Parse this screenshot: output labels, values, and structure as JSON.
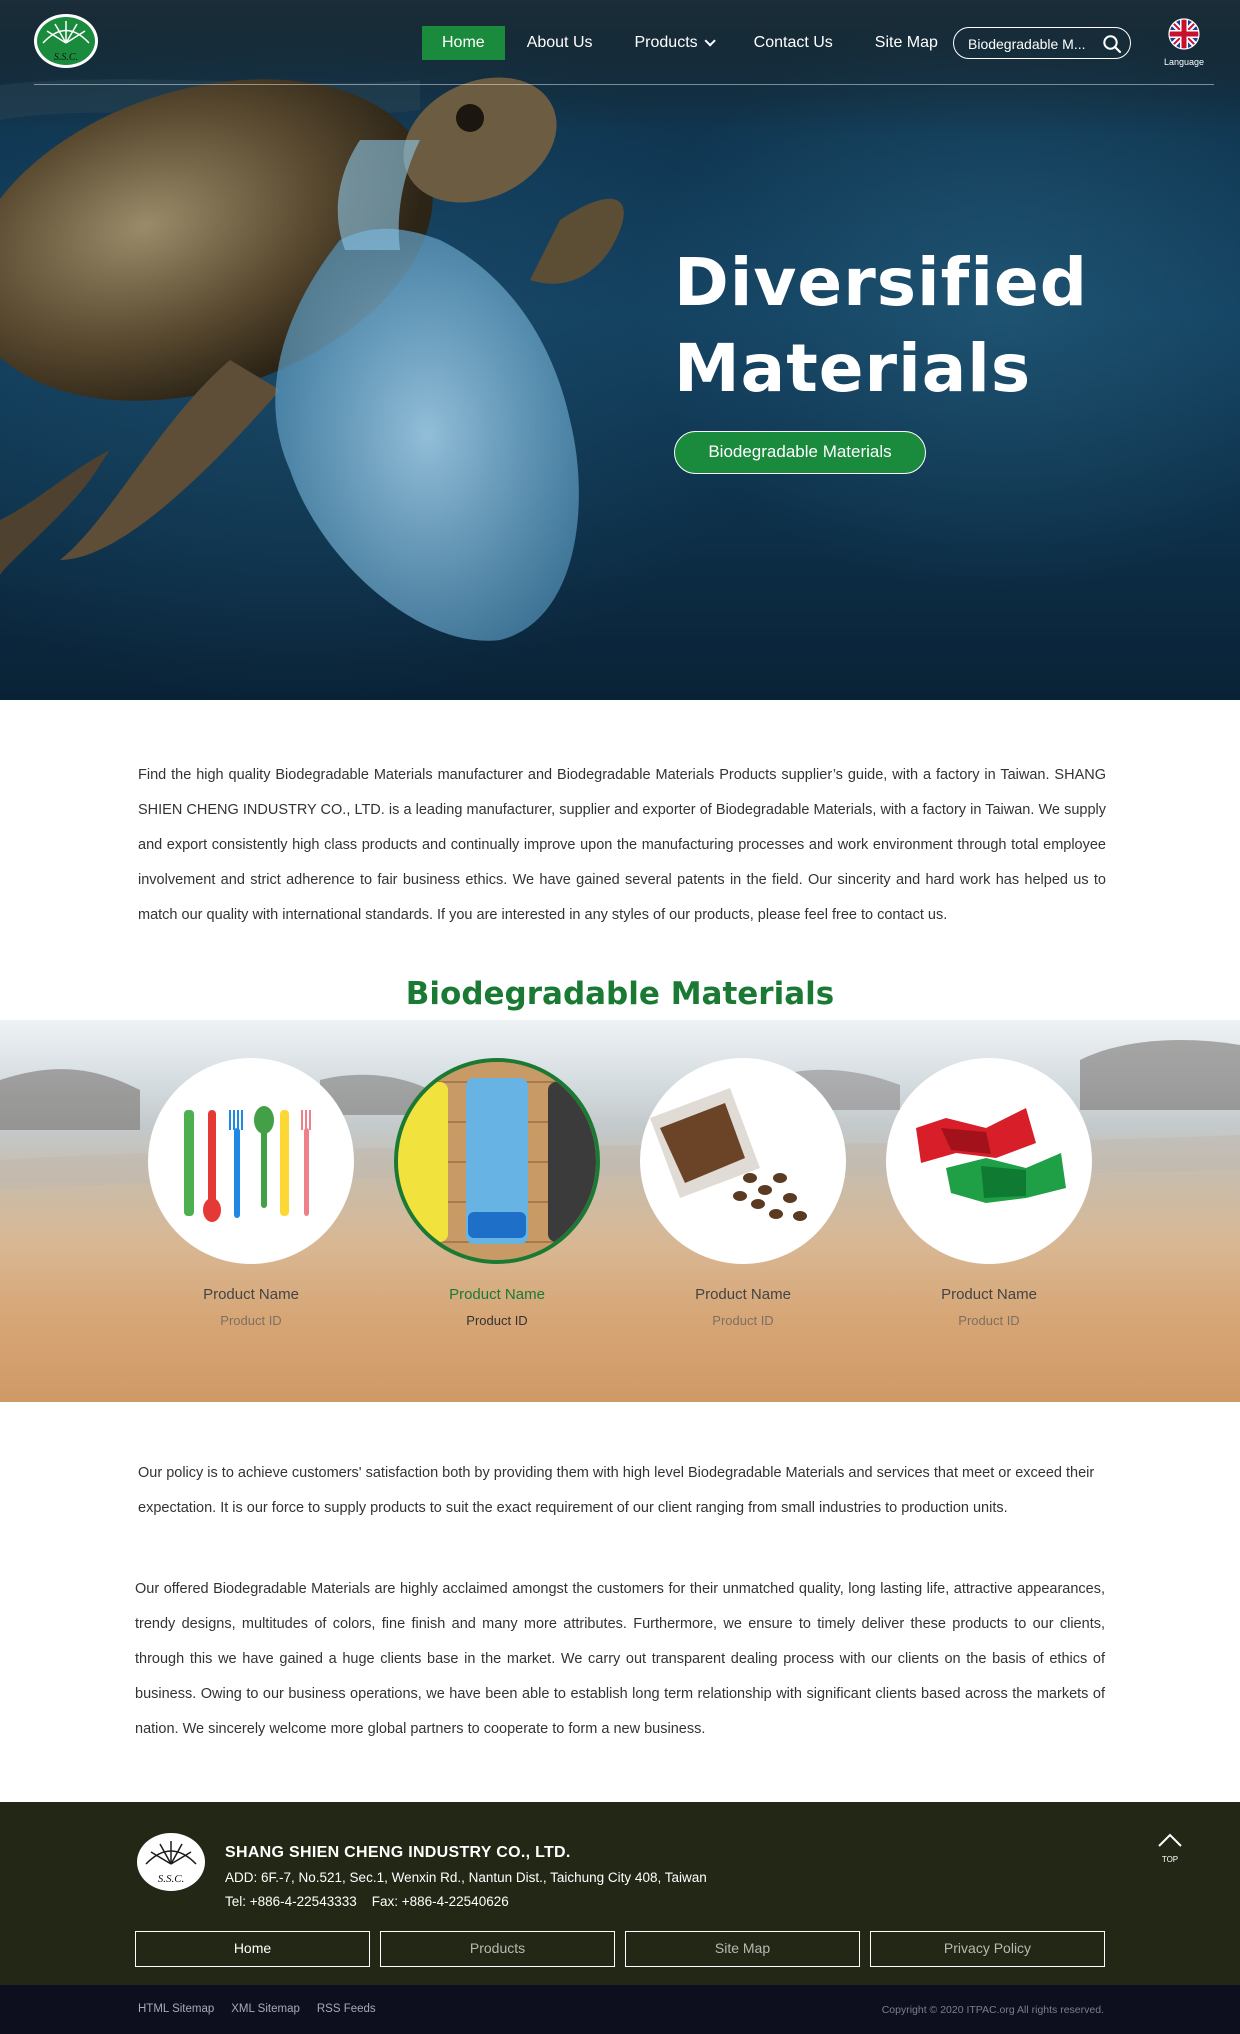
{
  "header": {
    "nav": [
      {
        "label": "Home",
        "active": true
      },
      {
        "label": "About Us",
        "active": false
      },
      {
        "label": "Products",
        "active": false,
        "has_dropdown": true
      },
      {
        "label": "Contact Us",
        "active": false
      },
      {
        "label": "Site Map",
        "active": false
      }
    ],
    "search": {
      "value": "Biodegradable M..."
    },
    "language_label": "Language",
    "logo_text": "S.S.C."
  },
  "hero": {
    "title_line1": "Diversified",
    "title_line2": "Materials",
    "button_label": "Biodegradable Materials"
  },
  "intro": {
    "text": "Find the high quality Biodegradable Materials manufacturer and Biodegradable Materials Products supplier’s guide, with a factory in Taiwan. SHANG SHIEN CHENG INDUSTRY CO., LTD. is a leading manufacturer, supplier and exporter of Biodegradable Materials, with a factory in Taiwan. We supply and export consistently high class products and continually improve upon the manufacturing processes and work environment through total employee involvement and strict adherence to fair business ethics. We have gained several patents in the field. Our sincerity and hard work has helped us to match our quality with international standards. If you are interested in any styles of our products, please feel free to contact us."
  },
  "products_section": {
    "title": "Biodegradable Materials",
    "items": [
      {
        "name": "Product Name",
        "id": "Product ID",
        "icon": "cutlery-image",
        "selected": false
      },
      {
        "name": "Product Name",
        "id": "Product ID",
        "icon": "bag-rolls-image",
        "selected": true
      },
      {
        "name": "Product Name",
        "id": "Product ID",
        "icon": "coffee-beans-image",
        "selected": false
      },
      {
        "name": "Product Name",
        "id": "Product ID",
        "icon": "candy-wrapper-image",
        "selected": false
      }
    ]
  },
  "policy": {
    "text": "Our policy is to achieve customers' satisfaction both by providing them with high level Biodegradable Materials and services that meet or exceed their expectation. It is our force to supply products to suit the exact requirement of our client ranging from small industries to production units."
  },
  "offered": {
    "text": "Our offered Biodegradable Materials are highly acclaimed amongst the customers for their unmatched quality, long lasting life, attractive appearances, trendy designs, multitudes of colors, fine finish and many more attributes. Furthermore, we ensure to timely deliver these products to our clients, through this we have gained a huge clients base in the market. We carry out transparent dealing process with our clients on the basis of ethics of business. Owing to our business operations, we have been able to establish long term relationship with significant clients based across the markets of nation. We sincerely welcome more global partners to cooperate to form a new business."
  },
  "footer": {
    "logo_text": "S.S.C.",
    "company": "SHANG SHIEN CHENG INDUSTRY CO., LTD.",
    "address": "ADD: 6F.-7, No.521, Sec.1, Wenxin Rd., Nantun Dist., Taichung City 408, Taiwan",
    "tel": "Tel: +886-4-22543333",
    "fax": "Fax: +886-4-22540626",
    "top_label": "TOP",
    "links": [
      "Home",
      "Products",
      "Site Map",
      "Privacy Policy"
    ],
    "bottom_links": [
      "HTML Sitemap",
      "XML Sitemap",
      "RSS Feeds"
    ],
    "copyright": "Copyright © 2020 ITPAC.org All rights reserved."
  },
  "colors": {
    "brand_green": "#1a8a3c",
    "footer_bg": "#232816",
    "bottom_bar_bg": "#0d0f1f"
  }
}
